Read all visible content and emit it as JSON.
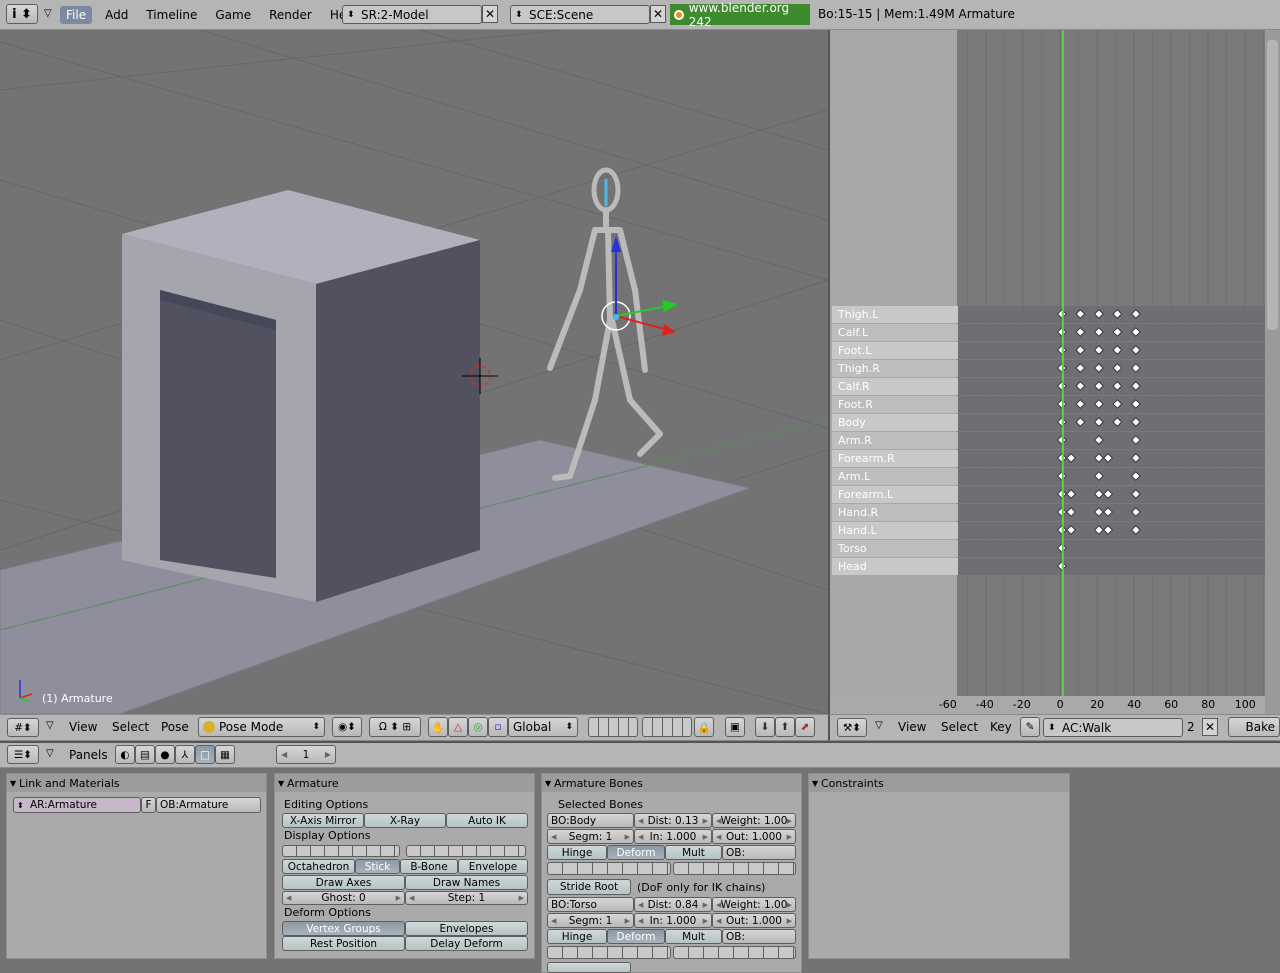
{
  "top_header": {
    "menus": [
      "File",
      "Add",
      "Timeline",
      "Game",
      "Render",
      "Help"
    ],
    "screen_field": "SR:2-Model",
    "scene_field": "SCE:Scene",
    "url_text": "www.blender.org 242",
    "stats": "Bo:15-15  | Mem:1.49M Armature"
  },
  "viewport": {
    "object_label": "(1) Armature",
    "header": {
      "menus": [
        "View",
        "Select",
        "Pose"
      ],
      "mode": "Pose Mode",
      "orientation": "Global"
    }
  },
  "action_editor": {
    "channels": [
      "Thigh.L",
      "Calf.L",
      "Foot.L",
      "Thigh.R",
      "Calf.R",
      "Foot.R",
      "Body",
      "Arm.R",
      "Forearm.R",
      "Arm.L",
      "Forearm.L",
      "Hand.R",
      "Hand.L",
      "Torso",
      "Head"
    ],
    "keyframes": [
      [
        1,
        11,
        21,
        31,
        41
      ],
      [
        1,
        11,
        21,
        31,
        41
      ],
      [
        1,
        11,
        21,
        31,
        41
      ],
      [
        1,
        11,
        21,
        31,
        41
      ],
      [
        1,
        11,
        21,
        31,
        41
      ],
      [
        1,
        11,
        21,
        31,
        41
      ],
      [
        1,
        11,
        21,
        31,
        41
      ],
      [
        1,
        21,
        41
      ],
      [
        1,
        6,
        21,
        26,
        41
      ],
      [
        1,
        21,
        41
      ],
      [
        1,
        6,
        21,
        26,
        41
      ],
      [
        1,
        6,
        21,
        26,
        41
      ],
      [
        1,
        6,
        21,
        26,
        41
      ],
      [
        1
      ],
      [
        1
      ]
    ],
    "current_frame": 1,
    "ruler_ticks": [
      "-60",
      "-40",
      "-20",
      "0",
      "20",
      "40",
      "60",
      "80",
      "100"
    ],
    "header": {
      "menus": [
        "View",
        "Select",
        "Key"
      ],
      "action_field": "AC:Walk",
      "users": "2",
      "bake_label": "Bake"
    }
  },
  "buttons_window": {
    "header": {
      "panels_label": "Panels",
      "frame_value": "1"
    },
    "link_panel": {
      "title": "Link and Materials",
      "armature_field": "AR:Armature",
      "fake_user": "F",
      "object_field": "OB:Armature"
    },
    "armature_panel": {
      "title": "Armature",
      "editing_options": "Editing Options",
      "x_axis_mirror": "X-Axis Mirror",
      "x_ray": "X-Ray",
      "auto_ik": "Auto IK",
      "display_options": "Display Options",
      "octahedron": "Octahedron",
      "stick": "Stick",
      "b_bone": "B-Bone",
      "envelope": "Envelope",
      "draw_axes": "Draw Axes",
      "draw_names": "Draw Names",
      "ghost": "Ghost: 0",
      "step": "Step: 1",
      "deform_options": "Deform Options",
      "vertex_groups": "Vertex Groups",
      "envelopes": "Envelopes",
      "rest_position": "Rest Position",
      "delay_deform": "Delay Deform"
    },
    "bones_panel": {
      "title": "Armature Bones",
      "selected_bones": "Selected Bones",
      "bone1": {
        "name": "BO:Body",
        "dist": "Dist: 0.13",
        "weight": "Weight: 1.00",
        "segm": "Segm: 1",
        "in": "In: 1.000",
        "out": "Out: 1.000"
      },
      "hinge": "Hinge",
      "deform": "Deform",
      "mult": "Mult",
      "ob": "OB:",
      "stride_root": "Stride Root",
      "dof_note": "(DoF only for IK chains)",
      "bone2": {
        "name": "BO:Torso",
        "dist": "Dist: 0.84",
        "weight": "Weight: 1.00",
        "segm": "Segm: 1",
        "in": "In: 1.000",
        "out": "Out: 1.000"
      }
    },
    "constraints_panel": {
      "title": "Constraints"
    }
  }
}
